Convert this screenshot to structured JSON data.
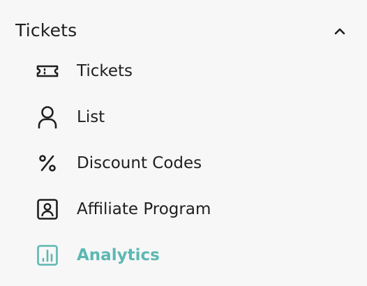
{
  "section": {
    "title": "Tickets",
    "expanded": true,
    "accent_color": "#5bb8b2",
    "text_color": "#1f1f1f",
    "toggle_icon": "chevron-up-icon"
  },
  "items": [
    {
      "label": "Tickets",
      "icon": "ticket-icon",
      "active": false
    },
    {
      "label": "List",
      "icon": "user-icon",
      "active": false
    },
    {
      "label": "Discount Codes",
      "icon": "percent-icon",
      "active": false
    },
    {
      "label": "Affiliate Program",
      "icon": "id-card-icon",
      "active": false
    },
    {
      "label": "Analytics",
      "icon": "bar-chart-icon",
      "active": true
    }
  ]
}
